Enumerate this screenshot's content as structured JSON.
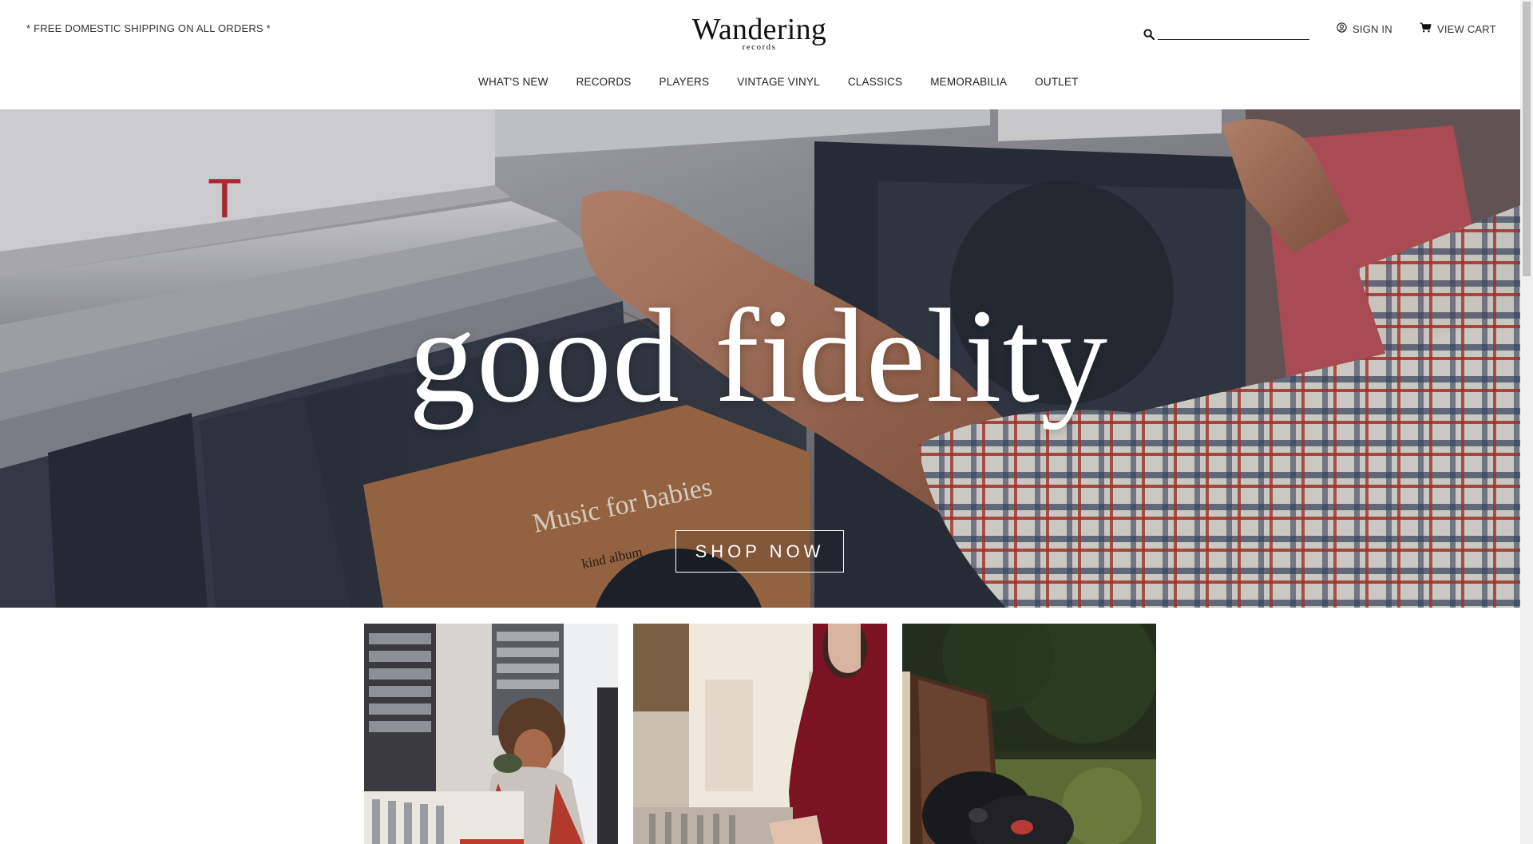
{
  "header": {
    "promo": "* FREE DOMESTIC SHIPPING ON ALL ORDERS *",
    "logo_main": "Wandering",
    "logo_sub": "records",
    "search_value": "",
    "search_icon": "search-icon",
    "sign_in": "SIGN IN",
    "sign_in_icon": "user-circle-icon",
    "view_cart": "VIEW CART",
    "cart_icon": "cart-icon"
  },
  "nav": {
    "items": [
      {
        "label": "WHAT'S NEW"
      },
      {
        "label": "RECORDS"
      },
      {
        "label": "PLAYERS"
      },
      {
        "label": "VINTAGE VINYL"
      },
      {
        "label": "CLASSICS"
      },
      {
        "label": "MEMORABILIA"
      },
      {
        "label": "OUTLET"
      }
    ]
  },
  "hero": {
    "title": "good fidelity",
    "cta": "SHOP NOW",
    "photo_text": {
      "divider_letter": "T",
      "album_title": "Music for babies",
      "album_subtitle": "kind album"
    }
  },
  "tiles": [
    {
      "subject": "woman-browsing-records-photo"
    },
    {
      "subject": "person-in-record-store-photo"
    },
    {
      "subject": "vintage-records-outdoors-photo"
    }
  ],
  "colors": {
    "text": "#222222",
    "background": "#ffffff",
    "hero_text": "#ffffff"
  }
}
